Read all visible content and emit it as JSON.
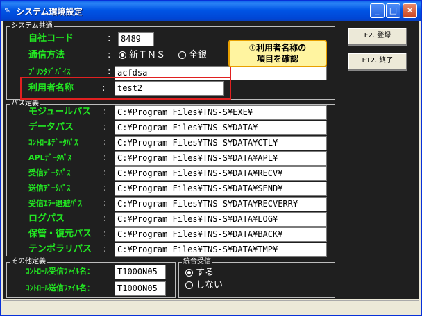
{
  "window": {
    "title": "システム環境設定"
  },
  "groups": {
    "system": "システム共通",
    "path": "パス定義",
    "other": "その他定義",
    "integrated": "統合受信"
  },
  "system": {
    "company_code_label": "自社コード",
    "company_code_value": "8489",
    "comm_method_label": "通信方法",
    "comm_options": [
      "新ＴＮＳ",
      "全銀"
    ],
    "printer_device_label": "ﾌﾟﾘﾝﾀﾃﾞﾊﾞｲｽ",
    "printer_device_value": "acfdsa",
    "user_name_label": "利用者名称",
    "user_name_value": "test2",
    "colon": ":"
  },
  "callout": {
    "line1": "①利用者名称の",
    "line2": "項目を確認"
  },
  "paths": [
    {
      "label": "モジュールパス",
      "value": "C:¥Program Files¥TNS-S¥EXE¥"
    },
    {
      "label": "データパス",
      "value": "C:¥Program Files¥TNS-S¥DATA¥"
    },
    {
      "label": "ｺﾝﾄﾛｰﾙﾃﾞｰﾀﾊﾟｽ",
      "value": "C:¥Program Files¥TNS-S¥DATA¥CTL¥"
    },
    {
      "label": "APLﾃﾞｰﾀﾊﾟｽ",
      "value": "C:¥Program Files¥TNS-S¥DATA¥APL¥"
    },
    {
      "label": "受信ﾃﾞｰﾀﾊﾟｽ",
      "value": "C:¥Program Files¥TNS-S¥DATA¥RECV¥"
    },
    {
      "label": "送信ﾃﾞｰﾀﾊﾟｽ",
      "value": "C:¥Program Files¥TNS-S¥DATA¥SEND¥"
    },
    {
      "label": "受信ｴﾗｰ退避ﾊﾟｽ",
      "value": "C:¥Program Files¥TNS-S¥DATA¥RECVERR¥"
    },
    {
      "label": "ログパス",
      "value": "C:¥Program Files¥TNS-S¥DATA¥LOG¥"
    },
    {
      "label": "保管・復元パス",
      "value": "C:¥Program Files¥TNS-S¥DATA¥BACK¥"
    },
    {
      "label": "テンポラリパス",
      "value": "C:¥Program Files¥TNS-S¥DATA¥TMP¥"
    }
  ],
  "other": {
    "ctl_recv_label": "ｺﾝﾄﾛｰﾙ受信ﾌｧｲﾙ名：",
    "ctl_recv_value": "T1000N05",
    "ctl_send_label": "ｺﾝﾄﾛｰﾙ送信ﾌｧｲﾙ名：",
    "ctl_send_value": "T1000N05"
  },
  "integrated": {
    "options": [
      "する",
      "しない"
    ]
  },
  "buttons": {
    "register": "F2. 登録",
    "exit": "F12. 終了"
  }
}
